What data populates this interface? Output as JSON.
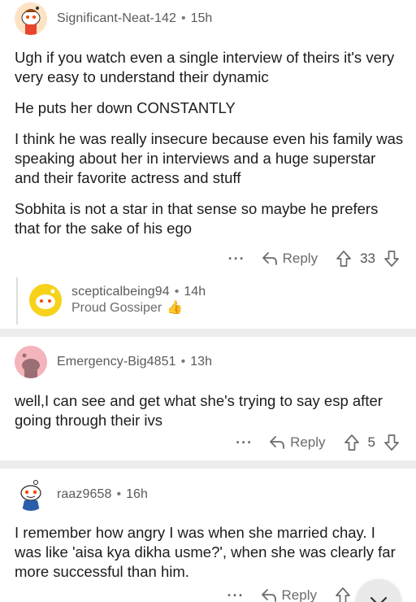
{
  "comments": [
    {
      "username": "Significant-Neat-142",
      "time": "15h",
      "paragraphs": [
        "Ugh if you watch even a single interview of theirs it's very very easy to understand their dynamic",
        "He puts her down CONSTANTLY",
        "I think he was really insecure because even his family was speaking about her in interviews and a huge superstar and their favorite actress and stuff",
        "Sobhita is not a star in that sense so maybe he prefers that for the sake of his ego"
      ],
      "more": "···",
      "reply": "Reply",
      "score": "33",
      "avatar_color": "#fbe3c4"
    },
    {
      "username": "scepticalbeing94",
      "time": "14h",
      "flair": "Proud Gossiper",
      "flair_icon": "thumbs-up-emoji",
      "avatar_color": "#f7d21a"
    },
    {
      "username": "Emergency-Big4851",
      "time": "13h",
      "paragraphs": [
        "well,I can see and get what she's trying to say esp after going through their ivs"
      ],
      "more": "···",
      "reply": "Reply",
      "score": "5",
      "avatar_color": "#f4b4bb"
    },
    {
      "username": "raaz9658",
      "time": "16h",
      "paragraphs": [
        "I remember how angry I was when she married chay. I was like 'aisa kya dikha usme?', when she was clearly far more successful than him."
      ],
      "more": "···",
      "reply": "Reply",
      "avatar_color": "#ffffff"
    }
  ],
  "dot": "•",
  "colors": {
    "divider": "#ececec",
    "meta": "#5a5a5a",
    "text": "#1c1c1c"
  }
}
